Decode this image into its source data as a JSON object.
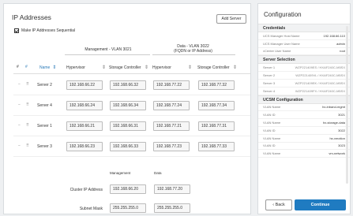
{
  "left": {
    "title": "IP Addresses",
    "add_server_label": "Add Server",
    "sequential_label": "Make IP Addresses Sequential",
    "mgmt_group": "Management - VLAN 3021",
    "data_group_line1": "Data - VLAN 3022",
    "data_group_line2": "(FQDN or IP Address)",
    "columns": {
      "hash": "#",
      "hash2": "#",
      "name": "Name",
      "hypervisor1": "Hypervisor",
      "storage1": "Storage Controller",
      "hypervisor2": "Hypervisor",
      "storage2": "Storage Controller"
    },
    "rows": [
      {
        "name": "Server 2",
        "h1": "192.168.66.22",
        "s1": "192.168.66.32",
        "h2": "192.168.77.22",
        "s2": "192.168.77.32"
      },
      {
        "name": "Server 4",
        "h1": "192.168.66.24",
        "s1": "192.168.66.34",
        "h2": "192.168.77.24",
        "s2": "192.168.77.34"
      },
      {
        "name": "Server 1",
        "h1": "192.168.66.21",
        "s1": "192.168.66.31",
        "h2": "192.168.77.21",
        "s2": "192.168.77.31"
      },
      {
        "name": "Server 3",
        "h1": "192.168.66.23",
        "s1": "192.168.66.33",
        "h2": "192.168.77.23",
        "s2": "192.168.77.33"
      }
    ],
    "bottom": {
      "mgmt_header": "Management",
      "data_header": "Data",
      "cluster_label": "Cluster IP Address",
      "cluster_mgmt": "192.168.66.20",
      "cluster_data": "192.168.77.20",
      "subnet_label": "Subnet Mask",
      "subnet_mgmt": "255.255.255.0",
      "subnet_data": "255.255.255.0"
    }
  },
  "config": {
    "title": "Configuration",
    "sections": [
      {
        "title": "Credentials",
        "items": [
          {
            "k": "UCS Manager Host Name",
            "v": "192.168.66.110"
          },
          {
            "k": "UCS Manager User Name",
            "v": "admin"
          },
          {
            "k": "vCenter User Name",
            "v": "root"
          }
        ]
      },
      {
        "title": "Server Selection",
        "items": [
          {
            "k": "Server 1",
            "v": "WZP221409ES / HXAF240C-M5SX"
          },
          {
            "k": "Server 2",
            "v": "WZP221409VL / HXAF240C-M5SX"
          },
          {
            "k": "Server 3",
            "v": "WZP221409EK / HXAF240C-M5SX"
          },
          {
            "k": "Server 4",
            "v": "WZP221409FX / HXAF240C-M5SX"
          }
        ]
      },
      {
        "title": "UCSM Configuration",
        "items": [
          {
            "k": "VLAN Name",
            "v": "hx-inband-mgmt"
          },
          {
            "k": "VLAN ID",
            "v": "3021"
          },
          {
            "k": "VLAN Name",
            "v": "hx-storage-data"
          },
          {
            "k": "VLAN ID",
            "v": "3022"
          },
          {
            "k": "VLAN Name",
            "v": "hx-vmotion"
          },
          {
            "k": "VLAN ID",
            "v": "3023"
          },
          {
            "k": "VLAN Name",
            "v": "vm-network"
          }
        ]
      }
    ],
    "back_label": "Back",
    "continue_label": "Continue",
    "back_chevron": "‹"
  },
  "icons": {
    "sort": "⇕",
    "minus": "−",
    "drag": "⠿"
  }
}
